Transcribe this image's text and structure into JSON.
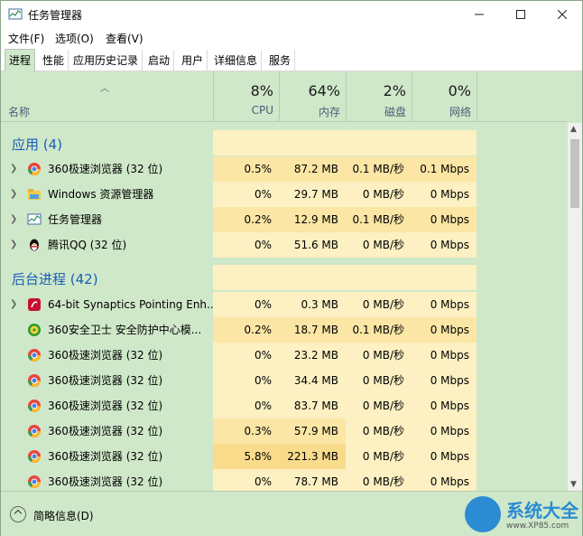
{
  "window": {
    "title": "任务管理器"
  },
  "menu": [
    {
      "label": "文件(F)"
    },
    {
      "label": "选项(O)"
    },
    {
      "label": "查看(V)"
    }
  ],
  "tabs": [
    {
      "label": "进程",
      "active": true
    },
    {
      "label": "性能"
    },
    {
      "label": "应用历史记录"
    },
    {
      "label": "启动"
    },
    {
      "label": "用户"
    },
    {
      "label": "详细信息"
    },
    {
      "label": "服务"
    }
  ],
  "header": {
    "name_label": "名称",
    "cpu": {
      "pct": "8%",
      "label": "CPU"
    },
    "mem": {
      "pct": "64%",
      "label": "内存"
    },
    "disk": {
      "pct": "2%",
      "label": "磁盘"
    },
    "net": {
      "pct": "0%",
      "label": "网络"
    }
  },
  "groups": {
    "apps": "应用 (4)",
    "background": "后台进程 (42)"
  },
  "apps": [
    {
      "name": "360极速浏览器 (32 位)",
      "cpu": "0.5%",
      "mem": "87.2 MB",
      "disk": "0.1 MB/秒",
      "net": "0.1 Mbps",
      "icon": "chrome-like-icon"
    },
    {
      "name": "Windows 资源管理器",
      "cpu": "0%",
      "mem": "29.7 MB",
      "disk": "0 MB/秒",
      "net": "0 Mbps",
      "icon": "explorer-icon"
    },
    {
      "name": "任务管理器",
      "cpu": "0.2%",
      "mem": "12.9 MB",
      "disk": "0.1 MB/秒",
      "net": "0 Mbps",
      "icon": "taskmgr-icon"
    },
    {
      "name": "腾讯QQ (32 位)",
      "cpu": "0%",
      "mem": "51.6 MB",
      "disk": "0 MB/秒",
      "net": "0 Mbps",
      "icon": "qq-icon"
    }
  ],
  "background": [
    {
      "name": "64-bit Synaptics Pointing Enh...",
      "cpu": "0%",
      "mem": "0.3 MB",
      "disk": "0 MB/秒",
      "net": "0 Mbps",
      "icon": "synaptics-icon"
    },
    {
      "name": "360安全卫士 安全防护中心模...",
      "cpu": "0.2%",
      "mem": "18.7 MB",
      "disk": "0.1 MB/秒",
      "net": "0 Mbps",
      "icon": "360-safe-icon"
    },
    {
      "name": "360极速浏览器 (32 位)",
      "cpu": "0%",
      "mem": "23.2 MB",
      "disk": "0 MB/秒",
      "net": "0 Mbps",
      "icon": "chrome-like-icon"
    },
    {
      "name": "360极速浏览器 (32 位)",
      "cpu": "0%",
      "mem": "34.4 MB",
      "disk": "0 MB/秒",
      "net": "0 Mbps",
      "icon": "chrome-like-icon"
    },
    {
      "name": "360极速浏览器 (32 位)",
      "cpu": "0%",
      "mem": "83.7 MB",
      "disk": "0 MB/秒",
      "net": "0 Mbps",
      "icon": "chrome-like-icon"
    },
    {
      "name": "360极速浏览器 (32 位)",
      "cpu": "0.3%",
      "mem": "57.9 MB",
      "disk": "0 MB/秒",
      "net": "0 Mbps",
      "icon": "chrome-like-icon"
    },
    {
      "name": "360极速浏览器 (32 位)",
      "cpu": "5.8%",
      "mem": "221.3 MB",
      "disk": "0 MB/秒",
      "net": "0 Mbps",
      "icon": "chrome-like-icon"
    },
    {
      "name": "360极速浏览器 (32 位)",
      "cpu": "0%",
      "mem": "78.7 MB",
      "disk": "0 MB/秒",
      "net": "0 Mbps",
      "icon": "chrome-like-icon"
    }
  ],
  "footer": {
    "label": "简略信息(D)"
  },
  "watermark": {
    "text": "系统大全",
    "url": "www.XP85.com"
  }
}
